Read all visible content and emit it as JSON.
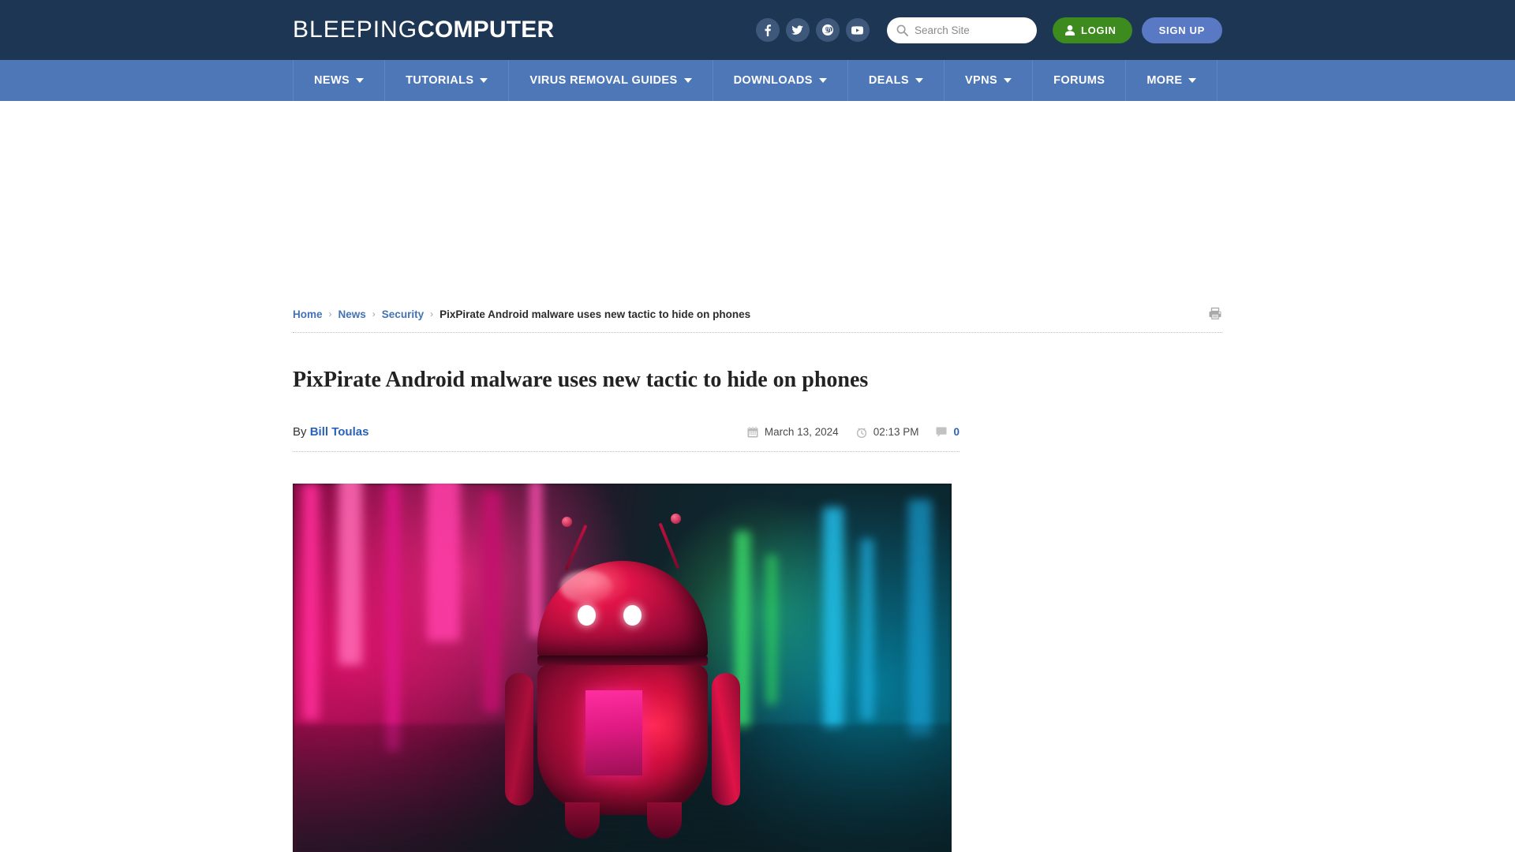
{
  "site": {
    "logo_light": "BLEEPING",
    "logo_bold": "COMPUTER"
  },
  "header": {
    "socials": [
      {
        "name": "facebook-icon",
        "label": "Facebook"
      },
      {
        "name": "twitter-icon",
        "label": "Twitter"
      },
      {
        "name": "mastodon-icon",
        "label": "Mastodon"
      },
      {
        "name": "youtube-icon",
        "label": "YouTube"
      }
    ],
    "search": {
      "placeholder": "Search Site",
      "value": "",
      "icon": "search-icon"
    },
    "login_label": "LOGIN",
    "signup_label": "SIGN UP",
    "login_color": "#3d8b1e",
    "signup_color": "#5a79c4",
    "background_color": "#1d3654"
  },
  "nav": {
    "background_color": "#4e77b8",
    "items": [
      {
        "label": "NEWS",
        "has_dropdown": true
      },
      {
        "label": "TUTORIALS",
        "has_dropdown": true
      },
      {
        "label": "VIRUS REMOVAL GUIDES",
        "has_dropdown": true
      },
      {
        "label": "DOWNLOADS",
        "has_dropdown": true
      },
      {
        "label": "DEALS",
        "has_dropdown": true
      },
      {
        "label": "VPNS",
        "has_dropdown": true
      },
      {
        "label": "FORUMS",
        "has_dropdown": false
      },
      {
        "label": "MORE",
        "has_dropdown": true
      }
    ]
  },
  "breadcrumb": {
    "links": [
      "Home",
      "News",
      "Security"
    ],
    "separator": "›",
    "current": "PixPirate Android malware uses new tactic to hide on phones",
    "print_icon": "printer-icon"
  },
  "article": {
    "title": "PixPirate Android malware uses new tactic to hide on phones",
    "by_prefix": "By",
    "author": "Bill Toulas",
    "date": "March 13, 2024",
    "date_icon": "calendar-icon",
    "time": "02:13 PM",
    "time_icon": "clock-icon",
    "comment_count": "0",
    "comment_icon": "comment-icon",
    "hero_image_alt": "Red glossy Android robot figure standing in a neon-lit cyberpunk street with pink and cyan reflections"
  }
}
